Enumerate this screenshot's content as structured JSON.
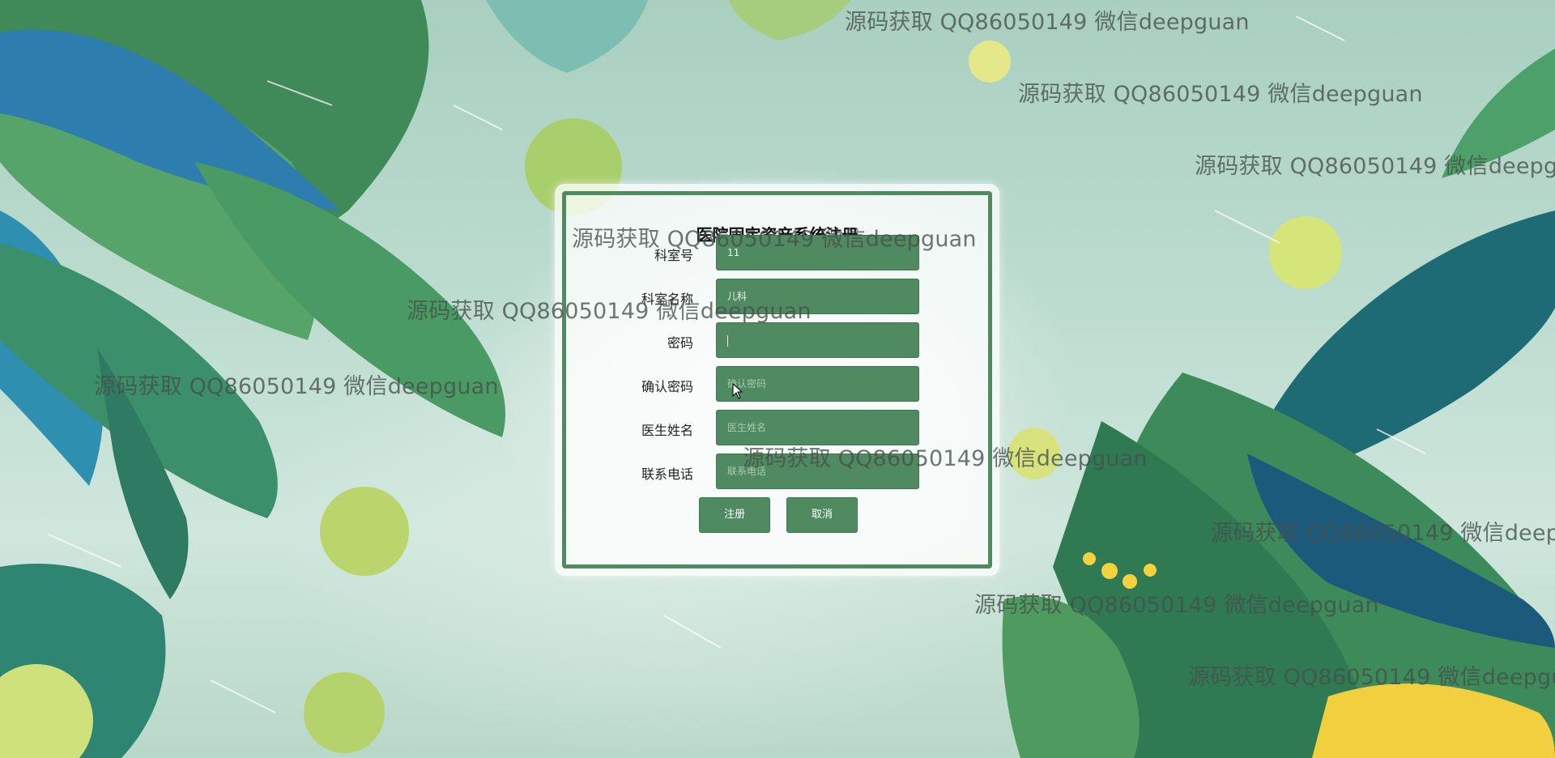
{
  "watermark_text": "源码获取 QQ86050149 微信deepguan",
  "form": {
    "title": "医院固定资产系统注册",
    "fields": [
      {
        "label": "科室号",
        "value": "11",
        "placeholder": ""
      },
      {
        "label": "科室名称",
        "value": "儿科",
        "placeholder": ""
      },
      {
        "label": "密码",
        "value": "",
        "placeholder": ""
      },
      {
        "label": "确认密码",
        "value": "",
        "placeholder": "确认密码"
      },
      {
        "label": "医生姓名",
        "value": "",
        "placeholder": "医生姓名"
      },
      {
        "label": "联系电话",
        "value": "",
        "placeholder": "联系电话"
      }
    ],
    "register_label": "注册",
    "cancel_label": "取消"
  },
  "colors": {
    "accent_green": "#4f8a61",
    "panel_bg": "rgba(255,255,255,0.78)"
  }
}
